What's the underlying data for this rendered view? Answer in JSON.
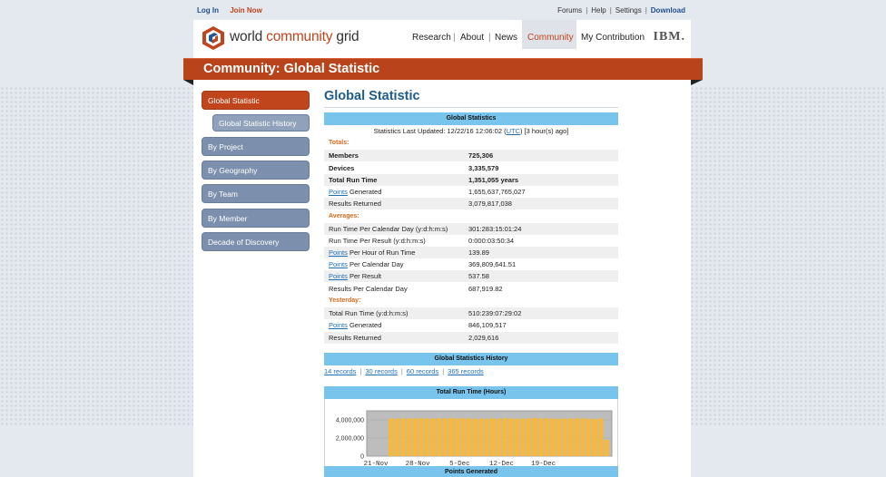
{
  "topbar": {
    "login": "Log In",
    "join": "Join Now",
    "forums": "Forums",
    "help": "Help",
    "settings": "Settings",
    "download": "Download",
    "sep": "|"
  },
  "header": {
    "logo_text_a": "world ",
    "logo_text_b": "community",
    "logo_text_c": " grid",
    "nav": {
      "research": "Research",
      "about": "About",
      "news": "News",
      "community": "Community",
      "contribution": "My Contribution"
    },
    "ibm": "IBM."
  },
  "banner": {
    "title": "Community:  Global Statistic"
  },
  "sidebar": {
    "items": [
      "Global Statistic",
      "Global Statistic History",
      "By Project",
      "By Geography",
      "By Team",
      "By Member",
      "Decade of Discovery"
    ]
  },
  "main": {
    "title": "Global Statistic",
    "stats_header": "Global Statistics",
    "updated_prefix": "Statistics Last Updated: 12/22/16 12:06:02 (",
    "updated_utc": "UTC",
    "updated_suffix": ") [3 hour(s) ago]",
    "totals_label": "Totals:",
    "totals": {
      "members_label": "Members",
      "members": "725,306",
      "devices_label": "Devices",
      "devices": "3,335,579",
      "runtime_label": "Total Run Time",
      "runtime": "1,351,055 years",
      "points_link": "Points",
      "points_label": " Generated",
      "points": "1,655,637,765,027",
      "results_label": "Results Returned",
      "results": "3,079,817,038"
    },
    "averages_label": "Averages:",
    "averages": {
      "rt_day_label": "Run Time Per Calendar Day (y:d:h:m:s)",
      "rt_day": "301:283:15:01:24",
      "rt_result_label": "Run Time Per Result (y:d:h:m:s)",
      "rt_result": "0:000:03:50:34",
      "pph_link": "Points",
      "pph_label": " Per Hour of Run Time",
      "pph": "139.89",
      "ppd_link": "Points",
      "ppd_label": " Per Calendar Day",
      "ppd": "369,809,641.51",
      "ppr_link": "Points",
      "ppr_label": " Per Result",
      "ppr": "537.58",
      "rpd_label": "Results Per Calendar Day",
      "rpd": "687,919.82"
    },
    "yesterday_label": "Yesterday:",
    "yesterday": {
      "rt_label": "Total Run Time (y:d:h:m:s)",
      "rt": "510:239:07:29:02",
      "points_link": "Points",
      "points_label": " Generated",
      "points": "846,109,517",
      "results_label": "Results Returned",
      "results": "2,029,616"
    },
    "history_header": "Global Statistics History",
    "records": [
      "14 records",
      "30 records",
      "60 records",
      "365 records"
    ],
    "records_sep": "|",
    "chart_header": "Total Run Time (Hours)",
    "points_header": "Points Generated"
  },
  "chart_data": {
    "type": "bar",
    "title": "Total Run Time (Hours)",
    "ylim": [
      0,
      5000000
    ],
    "yticks": [
      "4,000,000",
      "2,000,000",
      "0"
    ],
    "ytick_values": [
      4000000,
      2000000,
      0
    ],
    "xticks": [
      "21-Nov",
      "28-Nov",
      "5-Dec",
      "12-Dec",
      "19-Dec"
    ],
    "xtick_index": [
      0,
      7,
      14,
      21,
      28
    ],
    "bar_color": "#f5b840",
    "values": [
      4150000,
      4120000,
      4170000,
      4140000,
      4160000,
      4180000,
      4150000,
      4130000,
      4170000,
      4160000,
      4190000,
      4140000,
      4170000,
      4150000,
      4100000,
      4130000,
      4110000,
      4160000,
      4120000,
      4180000,
      4140000,
      4120000,
      4130000,
      4160000,
      4200000,
      4170000,
      4150000,
      4130000,
      4110000,
      4150000,
      4120000,
      4170000,
      4160000,
      4130000,
      4100000,
      4140000,
      1800000
    ]
  },
  "colors": {
    "accent": "#c0441c",
    "link": "#1f6fb5",
    "section": "#79c4ec",
    "sidebar": "#7c90ad"
  }
}
